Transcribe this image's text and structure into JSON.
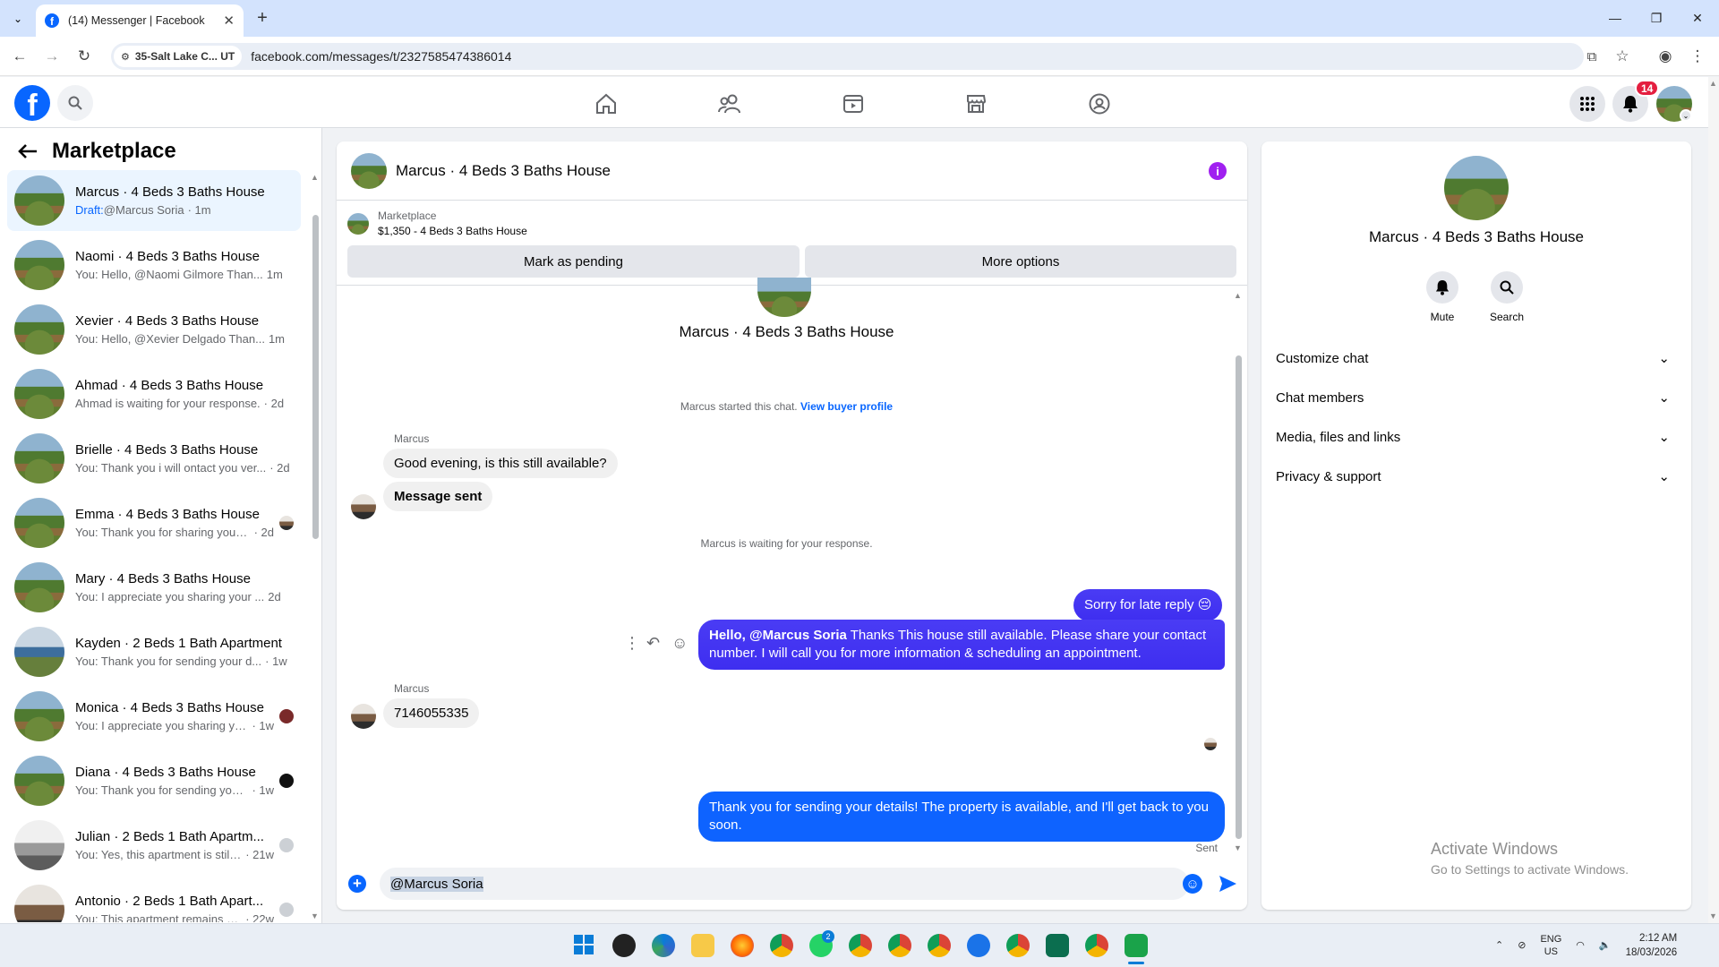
{
  "browser": {
    "tab_title": "(14) Messenger | Facebook",
    "site_chip": "35-Salt Lake C... UT",
    "url": "facebook.com/messages/t/2327585474386014"
  },
  "header": {
    "notification_count": "14"
  },
  "left_panel": {
    "title": "Marketplace",
    "conversations": [
      {
        "name": "Marcus · 4 Beds 3 Baths House",
        "draft": "Draft:",
        "snippet": " @Marcus Soria",
        "time": "· 1m",
        "active": true
      },
      {
        "name": "Naomi · 4 Beds 3 Baths House",
        "snippet": "You: Hello, @Naomi Gilmore Than...",
        "time": "1m"
      },
      {
        "name": "Xevier · 4 Beds 3 Baths House",
        "snippet": "You: Hello, @Xevier Delgado Than...",
        "time": "1m"
      },
      {
        "name": "Ahmad · 4 Beds 3 Baths House",
        "snippet": "Ahmad is waiting for your response.",
        "time": "· 2d"
      },
      {
        "name": "Brielle · 4 Beds 3 Baths House",
        "snippet": "You: Thank you i will ontact you ver...",
        "time": "· 2d"
      },
      {
        "name": "Emma · 4 Beds 3 Baths House",
        "snippet": "You: Thank you for sharing your ...",
        "time": "· 2d"
      },
      {
        "name": "Mary · 4 Beds 3 Baths House",
        "snippet": "You: I appreciate you sharing your ...",
        "time": "2d"
      },
      {
        "name": "Kayden · 2 Beds 1 Bath Apartment",
        "snippet": "You: Thank you for sending your d...",
        "time": "· 1w"
      },
      {
        "name": "Monica · 4 Beds 3 Baths House",
        "snippet": "You: I appreciate you sharing yo...",
        "time": "· 1w"
      },
      {
        "name": "Diana · 4 Beds 3 Baths House",
        "snippet": "You: Thank you for sending your...",
        "time": "· 1w"
      },
      {
        "name": "Julian · 2 Beds 1 Bath Apartm...",
        "snippet": "You: Yes, this apartment is still ...",
        "time": "· 21w"
      },
      {
        "name": "Antonio · 2 Beds 1 Bath Apart...",
        "snippet": "You: This apartment remains av...",
        "time": "· 22w"
      }
    ]
  },
  "chat": {
    "title": "Marcus · 4 Beds 3 Baths House",
    "marketplace_label": "Marketplace",
    "listing": "$1,350 - 4 Beds 3 Baths House",
    "mark_pending": "Mark as pending",
    "more_options": "More options",
    "conversation_title": "Marcus · 4 Beds 3 Baths House",
    "started_text": "Marcus started this chat.",
    "view_buyer": "View buyer profile",
    "sender1": "Marcus",
    "msg_in_1": "Good evening, is this still available?",
    "msg_in_2": "Message sent",
    "waiting": "Marcus is waiting for your response.",
    "msg_out_1": "Sorry for late reply 😔",
    "msg_out_2_mention": "Hello, @Marcus Soria",
    "msg_out_2_rest": " Thanks This house still available. Please share your contact number. I will call you for more information & scheduling an appointment.",
    "sender2": "Marcus",
    "msg_in_3": "7146055335",
    "msg_out_3": "Thank you for sending your details! The property is available, and I'll get back to you soon.",
    "status": "Sent",
    "composer_text": "@Marcus Soria"
  },
  "right_panel": {
    "name": "Marcus · 4 Beds 3 Baths House",
    "mute": "Mute",
    "search": "Search",
    "sections": [
      "Customize chat",
      "Chat members",
      "Media, files and links",
      "Privacy & support"
    ]
  },
  "watermark": {
    "line1": "Activate Windows",
    "line2": "Go to Settings to activate Windows."
  },
  "taskbar": {
    "lang1": "ENG",
    "lang2": "US",
    "time": "2:12 AM",
    "date": "18/03/2026",
    "whatsapp_badge": "2"
  },
  "colors": {
    "fb_blue": "#0866ff",
    "outgoing_bubble": "#3e2ef0",
    "notification_red": "#e41e3f"
  }
}
